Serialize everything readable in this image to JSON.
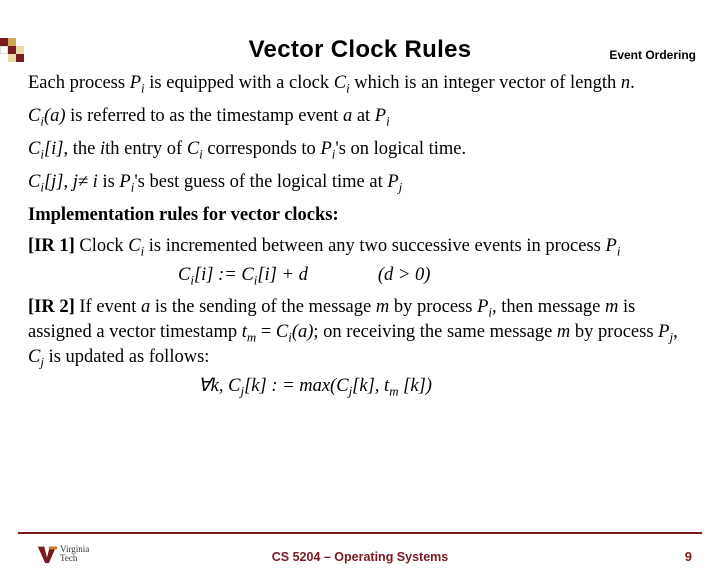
{
  "header": {
    "label": "Event Ordering"
  },
  "title": "Vector Clock Rules",
  "body": {
    "p1_a": "Each process ",
    "p1_b": " is equipped with a clock ",
    "p1_c": " which is an integer vector of length ",
    "p1_d": ".",
    "p2_a": " is referred to as the timestamp event ",
    "p2_b": " at ",
    "p3_a": ", the ",
    "p3_b": "th entry of ",
    "p3_c": " corresponds to ",
    "p3_d": "'s on logical time.",
    "p4_a": " is ",
    "p4_b": "'s best guess of the logical time at ",
    "p5": "Implementation rules for vector clocks:",
    "p6_a": "[IR 1]",
    "p6_b": " Clock ",
    "p6_c": " is incremented between any two successive events in process ",
    "f1_a": " := ",
    "f1_b": " + d",
    "f1_c": "(d > 0)",
    "p7_a": "[IR 2]",
    "p7_b": " If event ",
    "p7_c": " is the sending of the message ",
    "p7_d": " by process ",
    "p7_e": ", then message ",
    "p7_f": " is assigned a vector timestamp ",
    "p7_g": " = ",
    "p7_h": "; on receiving the same message ",
    "p7_i": " by process ",
    "p7_j": ", ",
    "p7_k": " is updated as follows:",
    "f2_a": "∀",
    "f2_b": " : = max(",
    "f2_c": ", ",
    "f2_d": ")",
    "sym": {
      "Pi": {
        "base": "P",
        "sub": "i"
      },
      "Pj": {
        "base": "P",
        "sub": "j"
      },
      "Ci": {
        "base": "C",
        "sub": "i"
      },
      "Cj": {
        "base": "C",
        "sub": "j"
      },
      "Cia": {
        "base": "C",
        "sub": "i",
        "arg": "(a)"
      },
      "Cii": {
        "base": "C",
        "sub": "i",
        "arg": "[i]"
      },
      "Cij": {
        "base": "C",
        "sub": "i",
        "arg": "[j]"
      },
      "Cjk": {
        "base": "C",
        "sub": "j",
        "arg": "[k]"
      },
      "tm": {
        "base": "t",
        "sub": "m"
      },
      "tmk": {
        "base": "t",
        "sub": "m",
        "arg": " [k]"
      },
      "n": "n",
      "a": "a",
      "i": "i",
      "m": "m",
      "k": "k",
      "jnei": "j≠ i"
    }
  },
  "footer": {
    "course": "CS 5204 – Operating Systems",
    "page": "9",
    "logo": {
      "line1": "Virginia",
      "line2": "Tech"
    }
  },
  "decor": {
    "colors": {
      "dark": "#7a1b20",
      "mid": "#c9a85a",
      "light": "#e8d9a8",
      "white": "#ffffff"
    }
  }
}
